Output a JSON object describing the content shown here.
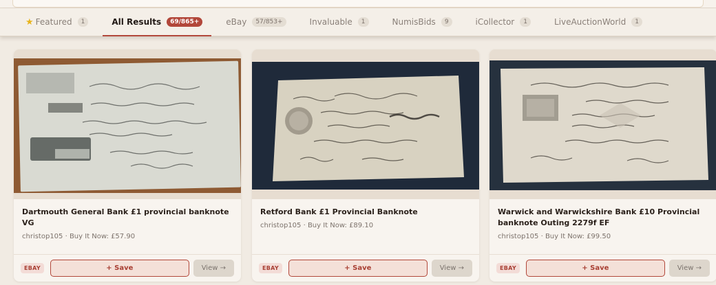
{
  "tabs": [
    {
      "label": "Featured",
      "count": "1",
      "icon": "star-icon"
    },
    {
      "label": "All Results",
      "count": "69/865+",
      "active": true
    },
    {
      "label": "eBay",
      "count": "57/853+"
    },
    {
      "label": "Invaluable",
      "count": "1"
    },
    {
      "label": "NumisBids",
      "count": "9"
    },
    {
      "label": "iCollector",
      "count": "1"
    },
    {
      "label": "LiveAuctionWorld",
      "count": "1"
    }
  ],
  "cards": [
    {
      "title": "Dartmouth General Bank £1 provincial banknote VG",
      "meta": "christop105 · Buy It Now: £57.90",
      "source": "EBAY",
      "save_label": "+ Save",
      "view_label": "View →"
    },
    {
      "title": "Retford Bank £1 Provincial Banknote",
      "meta": "christop105 · Buy It Now: £89.10",
      "source": "EBAY",
      "save_label": "+ Save",
      "view_label": "View →"
    },
    {
      "title": "Warwick and Warwickshire Bank £10 Provincial banknote Outing 2279f EF",
      "meta": "christop105 · Buy It Now: £99.50",
      "source": "EBAY",
      "save_label": "+ Save",
      "view_label": "View →"
    }
  ],
  "colors": {
    "accent": "#b2473a",
    "background": "#f1ebe3",
    "card": "#f8f4ef"
  }
}
